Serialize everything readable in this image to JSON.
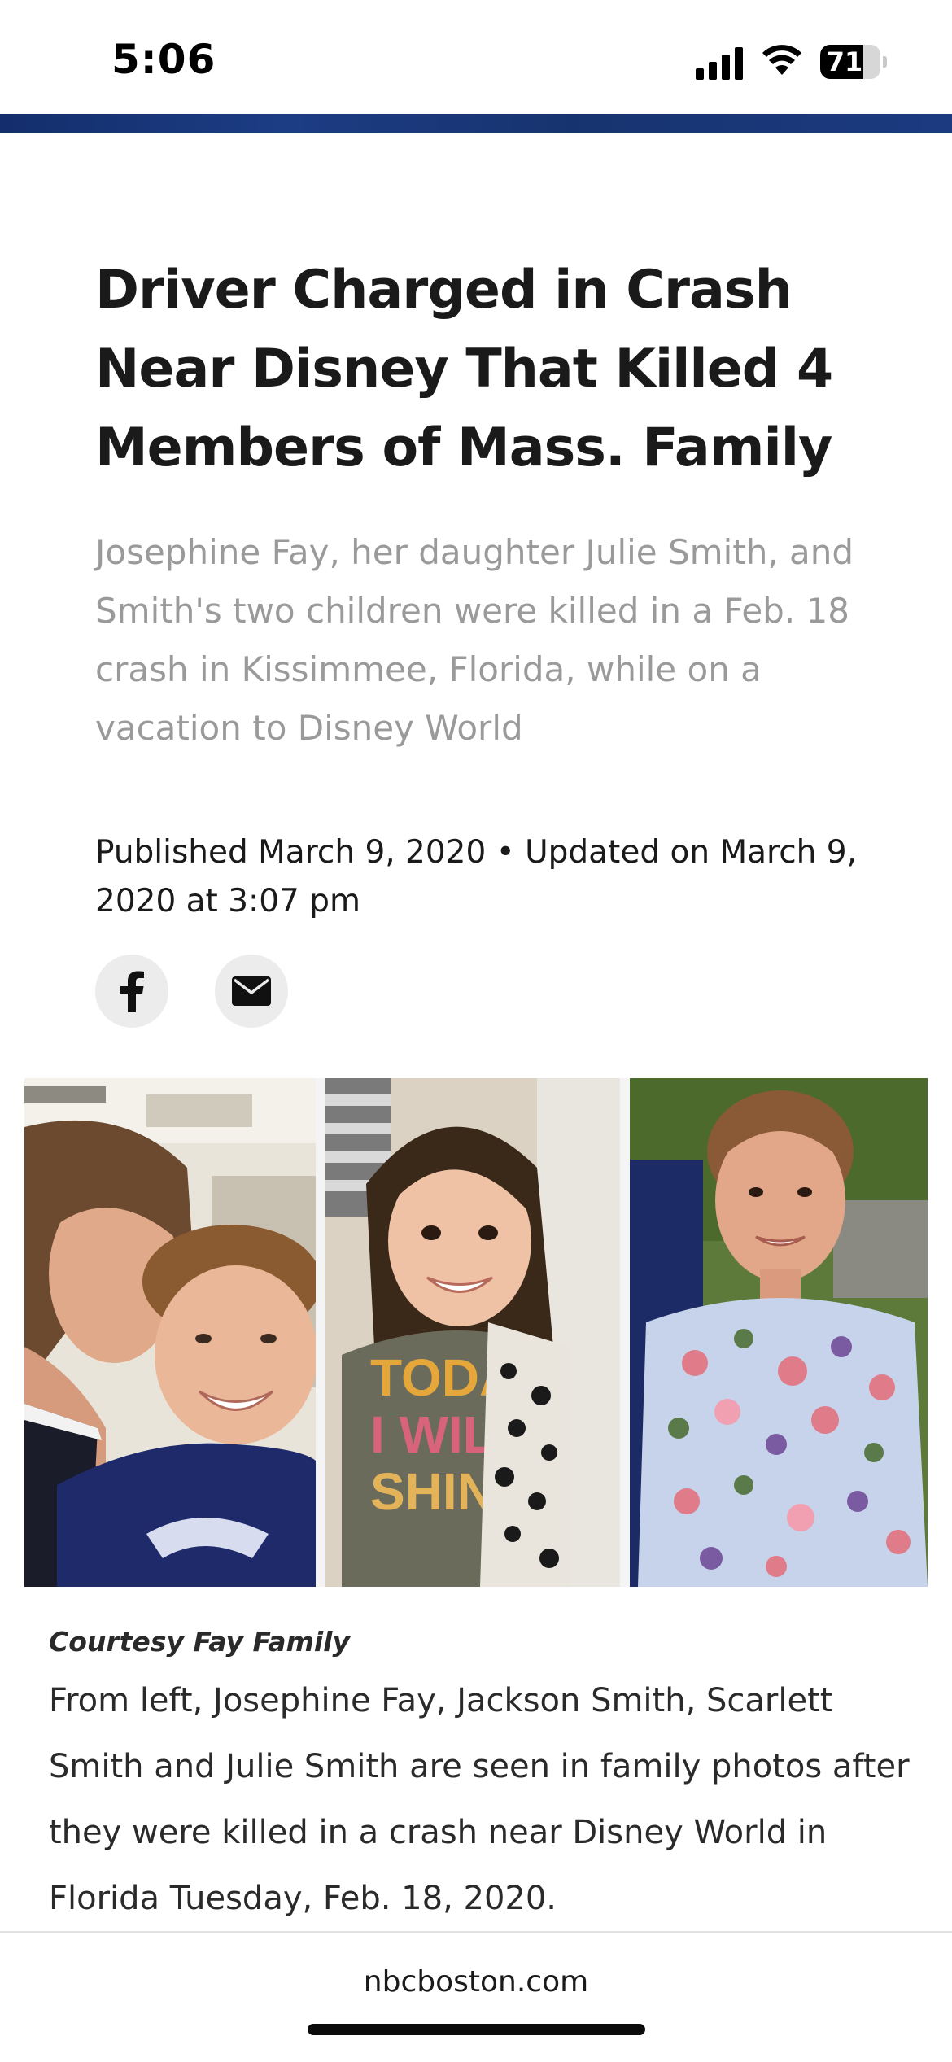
{
  "status_bar": {
    "time": "5:06",
    "battery_level": "71",
    "battery_fraction": 0.71
  },
  "article": {
    "headline": "Driver Charged in Crash Near Disney That Killed 4 Members of Mass. Family",
    "dek": "Josephine Fay, her daughter Julie Smith, and Smith's two children were killed in a Feb. 18 crash in Kissimmee, Florida, while on a vacation to Disney World",
    "byline": "Published March 9, 2020 • Updated on March 9, 2020 at 3:07 pm"
  },
  "share": {
    "icons": [
      "facebook-icon",
      "email-icon"
    ]
  },
  "photo": {
    "credit": "Courtesy Fay Family",
    "caption": "From left, Josephine Fay, Jackson Smith, Scarlett Smith and Julie Smith are seen in family photos after they were killed in a crash near Disney World in Florida Tuesday, Feb. 18, 2020."
  },
  "browser": {
    "url": "nbcboston.com"
  },
  "colors": {
    "header_strip": "#1a3575",
    "headline": "#1a1a1a",
    "dek": "#9a9a9a",
    "share_bg": "#ececec"
  }
}
